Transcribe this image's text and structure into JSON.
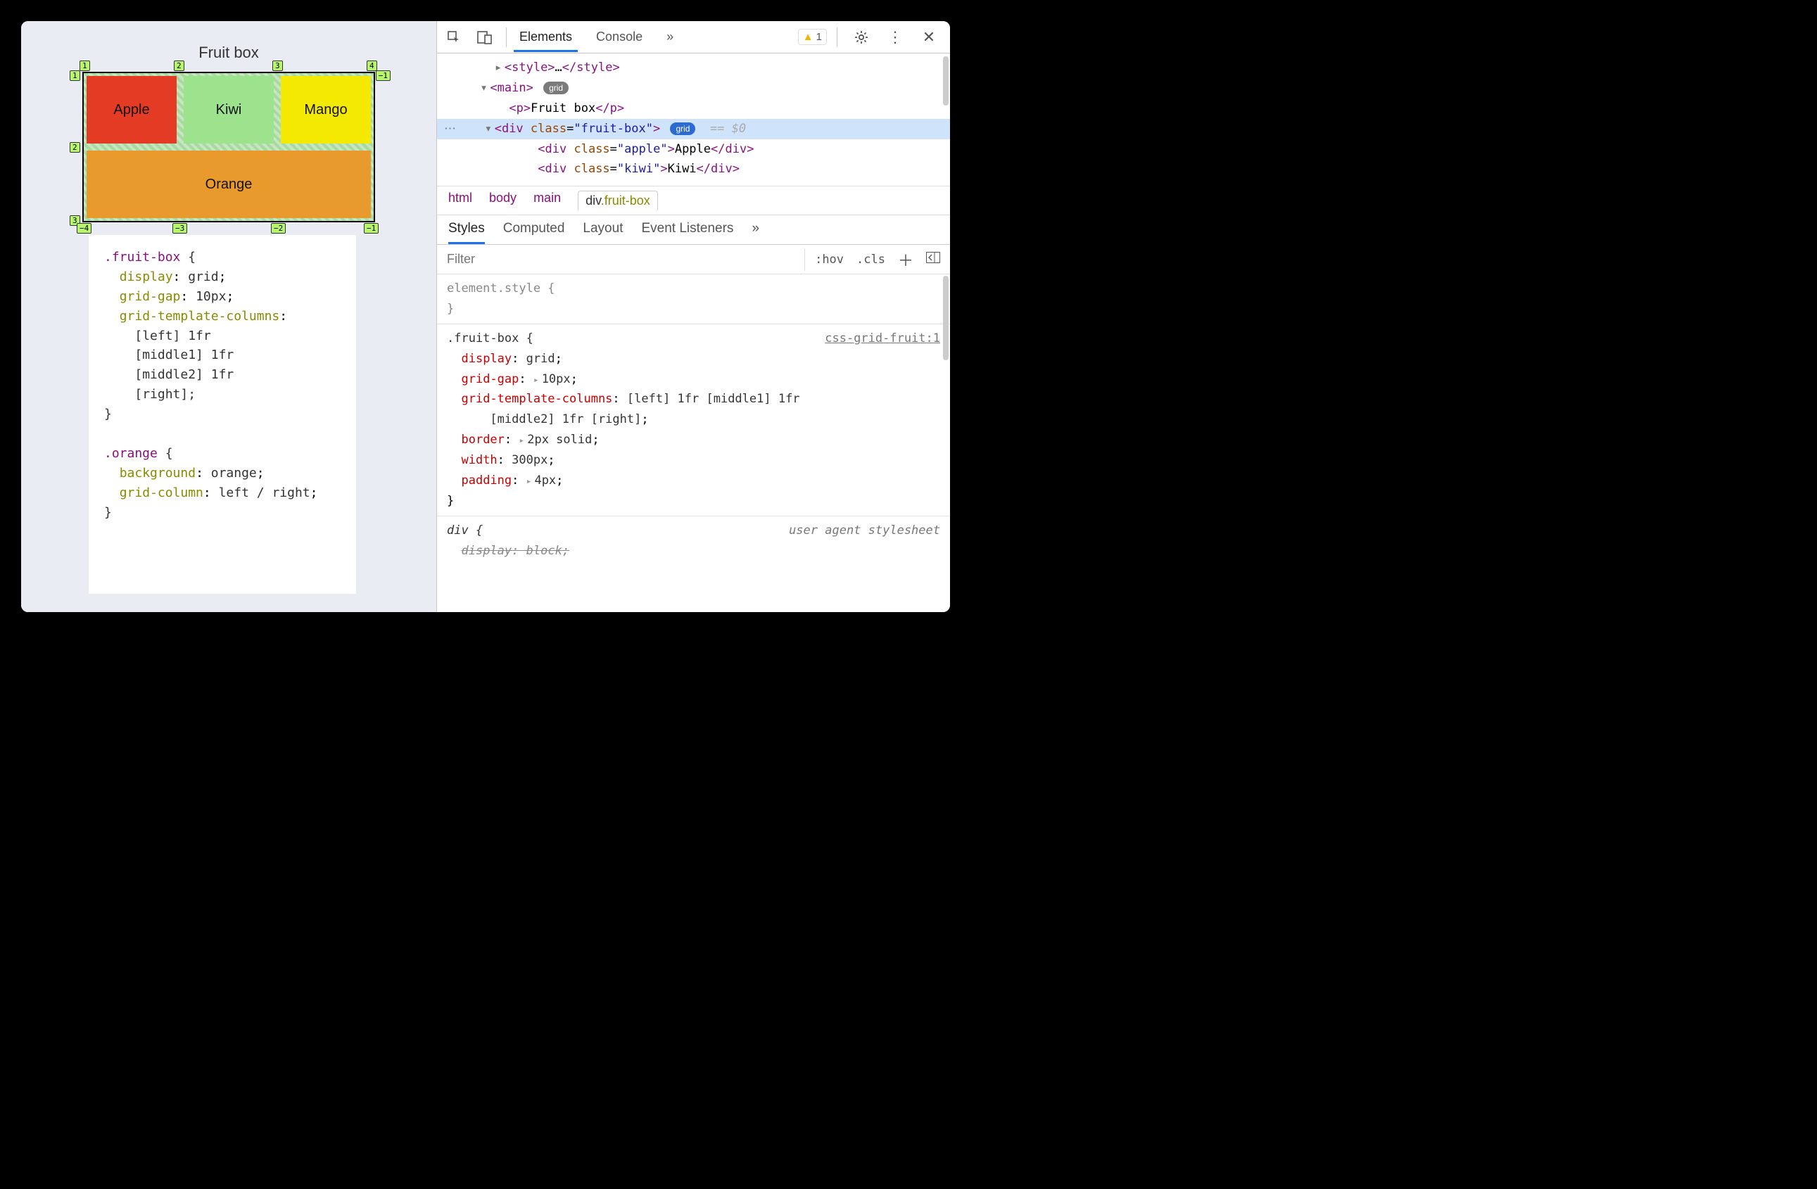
{
  "page": {
    "title": "Fruit box",
    "cells": {
      "apple": "Apple",
      "kiwi": "Kiwi",
      "mango": "Mango",
      "orange": "Orange"
    },
    "grid_labels": {
      "cols_top": [
        "1",
        "2",
        "3",
        "4"
      ],
      "rows_left": [
        "1",
        "2",
        "3"
      ],
      "cols_bottom": [
        "−4",
        "−3",
        "−2",
        "−1"
      ],
      "row_right": "−1"
    },
    "code1_selector": ".fruit-box",
    "code1_lines": [
      [
        "display",
        "grid"
      ],
      [
        "grid-gap",
        "10px"
      ],
      [
        "grid-template-columns",
        ""
      ]
    ],
    "code1_gtc_lines": [
      "[left] 1fr",
      "[middle1] 1fr",
      "[middle2] 1fr",
      "[right];"
    ],
    "code2_selector": ".orange",
    "code2_lines": [
      [
        "background",
        "orange"
      ],
      [
        "grid-column",
        "left / right"
      ]
    ]
  },
  "devtools": {
    "tabs": {
      "elements": "Elements",
      "console": "Console"
    },
    "warn_count": "1",
    "dom": {
      "style_open": "<style>",
      "style_ell": "…",
      "style_close": "</style>",
      "main_open": "<main>",
      "main_pill": "grid",
      "p_open": "<p>",
      "p_text": "Fruit box",
      "p_close": "</p>",
      "div_open_pre": "<div ",
      "div_attr": "class",
      "div_val": "\"fruit-box\"",
      "div_open_post": ">",
      "div_pill": "grid",
      "eq0": "== $0",
      "apple": {
        "open": "<div ",
        "attr": "class",
        "val": "\"apple\"",
        "text": "Apple",
        "close": "</div>"
      },
      "kiwi": {
        "open": "<div ",
        "attr": "class",
        "val": "\"kiwi\"",
        "text": "Kiwi",
        "close": "</div>"
      }
    },
    "crumbs": [
      "html",
      "body",
      "main"
    ],
    "crumb_active_el": "div",
    "crumb_active_cls": ".fruit-box",
    "subtabs": {
      "styles": "Styles",
      "computed": "Computed",
      "layout": "Layout",
      "events": "Event Listeners"
    },
    "filter_placeholder": "Filter",
    "filter_tools": {
      "hov": ":hov",
      "cls": ".cls"
    },
    "styles": {
      "element_style": "element.style {",
      "rule_sel": ".fruit-box {",
      "rule_src": "css-grid-fruit:1",
      "decls": [
        [
          "display",
          "grid",
          ""
        ],
        [
          "grid-gap",
          "10px",
          "exp"
        ],
        [
          "grid-template-columns",
          "[left] 1fr [middle1] 1fr [middle2] 1fr [right]",
          ""
        ],
        [
          "border",
          "2px solid",
          "exp"
        ],
        [
          "width",
          "300px",
          ""
        ],
        [
          "padding",
          "4px",
          "exp"
        ]
      ],
      "ua_label": "user agent stylesheet",
      "ua_sel": "div {",
      "ua_decl_prop": "display",
      "ua_decl_val": "block"
    }
  }
}
